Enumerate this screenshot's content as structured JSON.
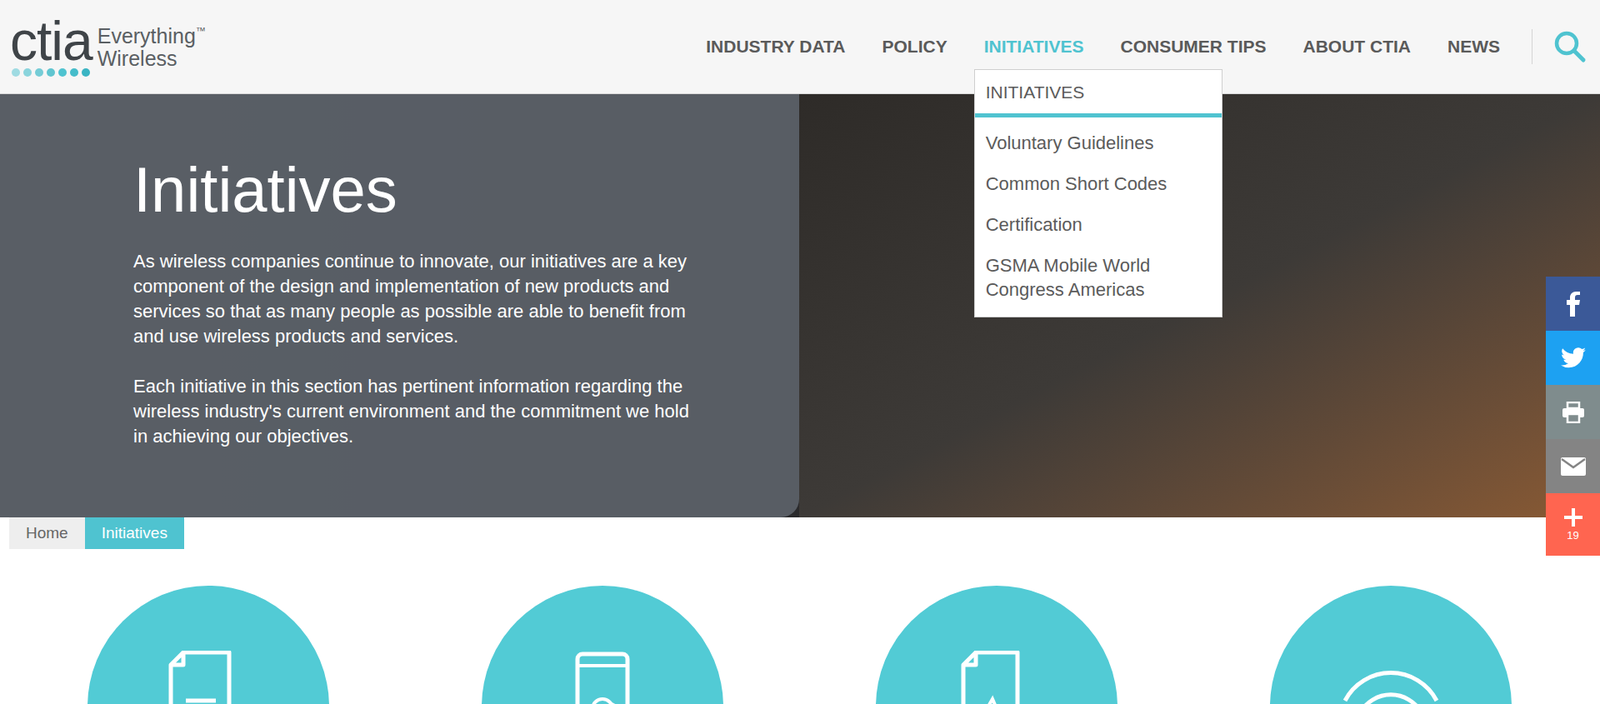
{
  "logo": {
    "wordmark": "ctia",
    "tagline_top": "Everything",
    "trademark": "™",
    "tagline_bottom": "Wireless"
  },
  "nav": [
    {
      "label": "INDUSTRY DATA",
      "selected": false
    },
    {
      "label": "POLICY",
      "selected": false
    },
    {
      "label": "INITIATIVES",
      "selected": true
    },
    {
      "label": "CONSUMER TIPS",
      "selected": false
    },
    {
      "label": "ABOUT CTIA",
      "selected": false
    },
    {
      "label": "NEWS",
      "selected": false
    }
  ],
  "dropdown": {
    "header": "INITIATIVES",
    "items": [
      "Voluntary Guidelines",
      "Common Short Codes",
      "Certification",
      "GSMA Mobile World Congress Americas"
    ]
  },
  "hero": {
    "title": "Initiatives",
    "paragraphs": [
      "As wireless companies continue to innovate, our initiatives are a key component of the design and implementation of new products and services so that as many people as possible are able to benefit from and use wireless products and services.",
      "Each initiative in this section has pertinent information regarding the wireless industry's current environment and the commitment we hold in achieving our objectives."
    ]
  },
  "share": {
    "count": "19"
  },
  "breadcrumb": [
    {
      "label": "Home",
      "selected": false
    },
    {
      "label": "Initiatives",
      "selected": true
    }
  ]
}
